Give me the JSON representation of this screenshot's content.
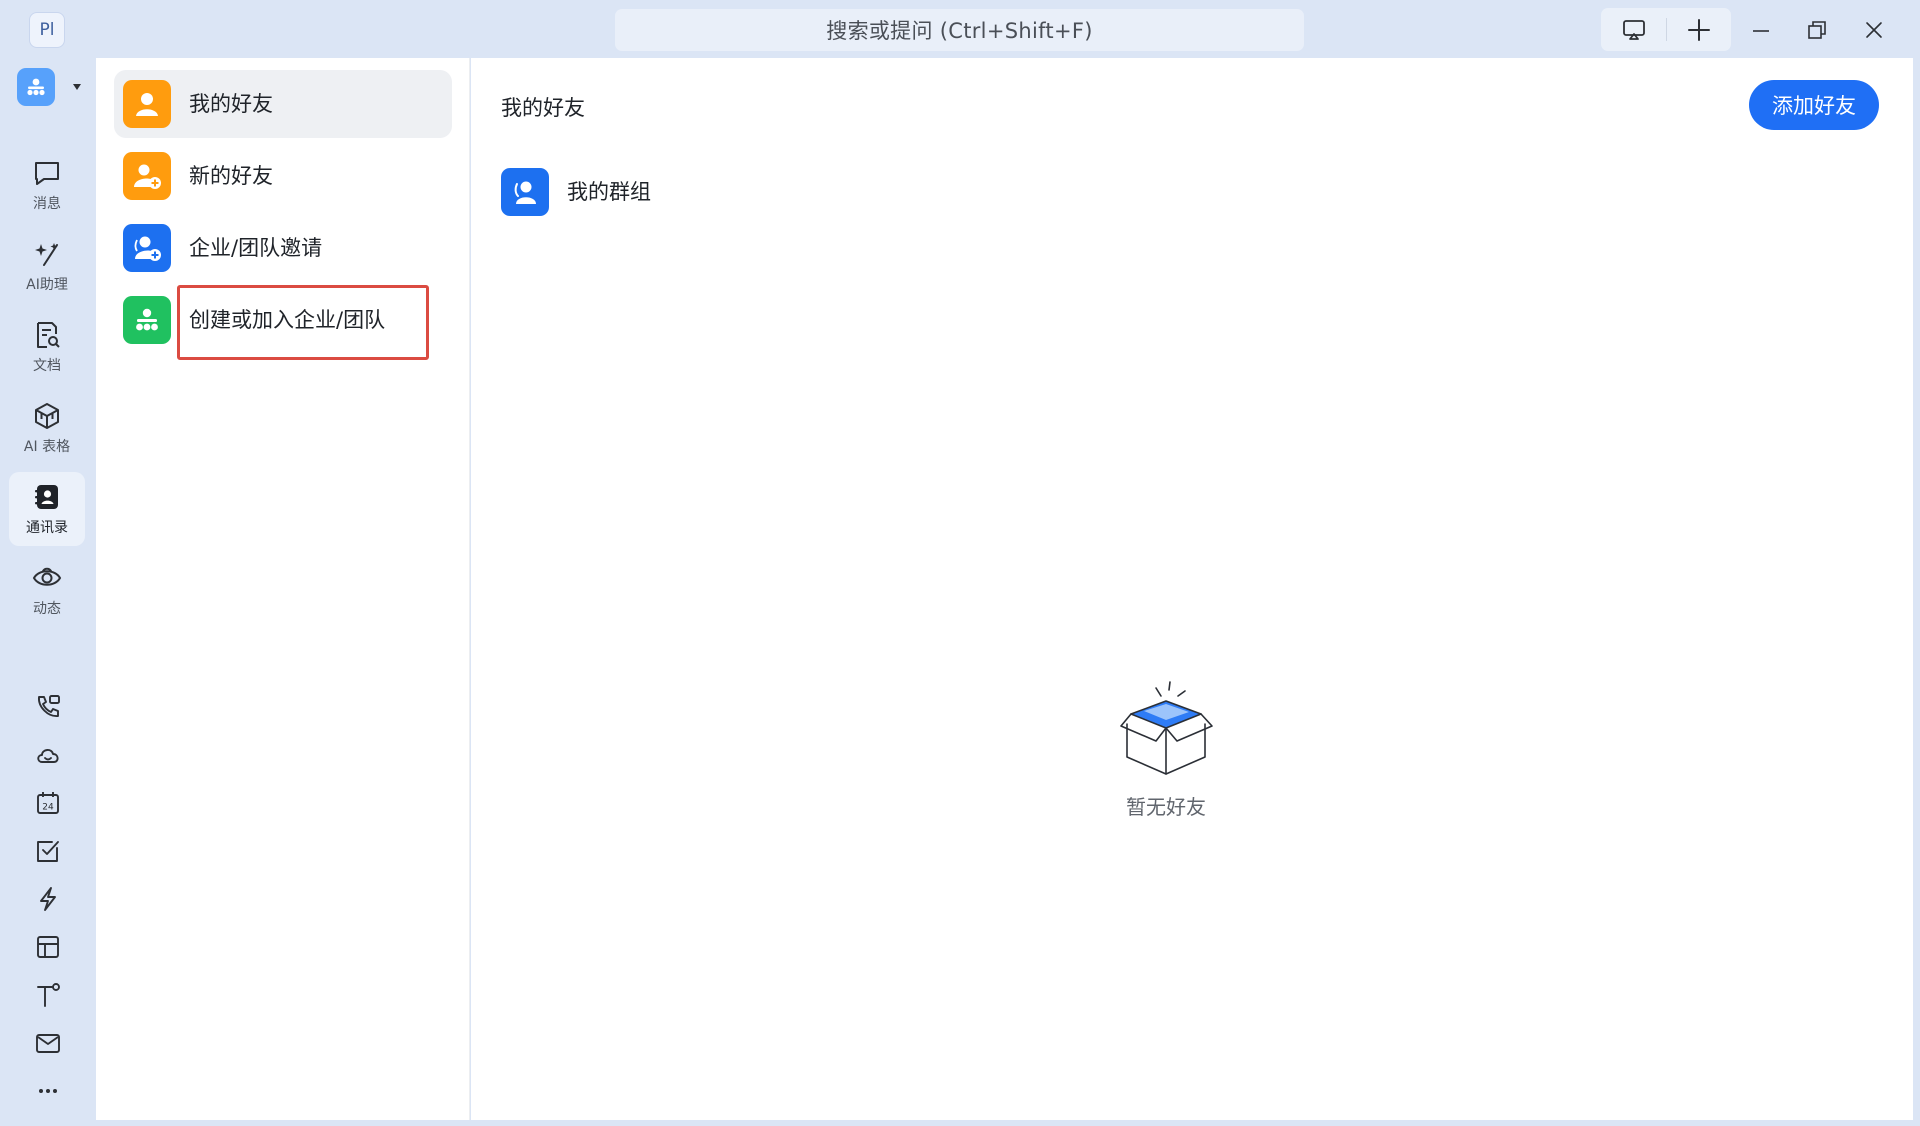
{
  "titlebar": {
    "app_avatar_text": "Pl",
    "search_placeholder": "搜索或提问 (Ctrl+Shift+F)",
    "buttons": [
      "screen-share-icon",
      "plus-icon"
    ],
    "window_controls": [
      "minimize-icon",
      "restore-icon",
      "close-icon"
    ]
  },
  "nav": {
    "items": [
      {
        "label": "消息",
        "icon": "message-icon"
      },
      {
        "label": "AI助理",
        "icon": "ai-sparkle-icon"
      },
      {
        "label": "文档",
        "icon": "document-icon"
      },
      {
        "label": "AI 表格",
        "icon": "ai-table-icon"
      },
      {
        "label": "通讯录",
        "icon": "contacts-icon",
        "active": true
      },
      {
        "label": "动态",
        "icon": "eye-icon"
      }
    ],
    "tools": [
      "phone-icon",
      "cloud-icon",
      "calendar-icon",
      "todo-icon",
      "lightning-icon",
      "box-icon",
      "text-icon",
      "mail-icon",
      "more-icon"
    ],
    "calendar_day": "24"
  },
  "contacts_menu": {
    "items": [
      {
        "label": "我的好友",
        "icon": "user-icon",
        "active": true
      },
      {
        "label": "新的好友",
        "icon": "add-user-icon"
      },
      {
        "label": "企业/团队邀请",
        "icon": "team-invite-icon"
      },
      {
        "label": "创建或加入企业/团队",
        "icon": "org-icon",
        "highlighted": true
      }
    ]
  },
  "main": {
    "title": "我的好友",
    "add_button": "添加好友",
    "group_label": "我的群组",
    "empty_text": "暂无好友"
  },
  "colors": {
    "accent": "#1f6ff5",
    "orange": "#ff9c0e",
    "green": "#20c160",
    "highlight": "#db4b41"
  }
}
